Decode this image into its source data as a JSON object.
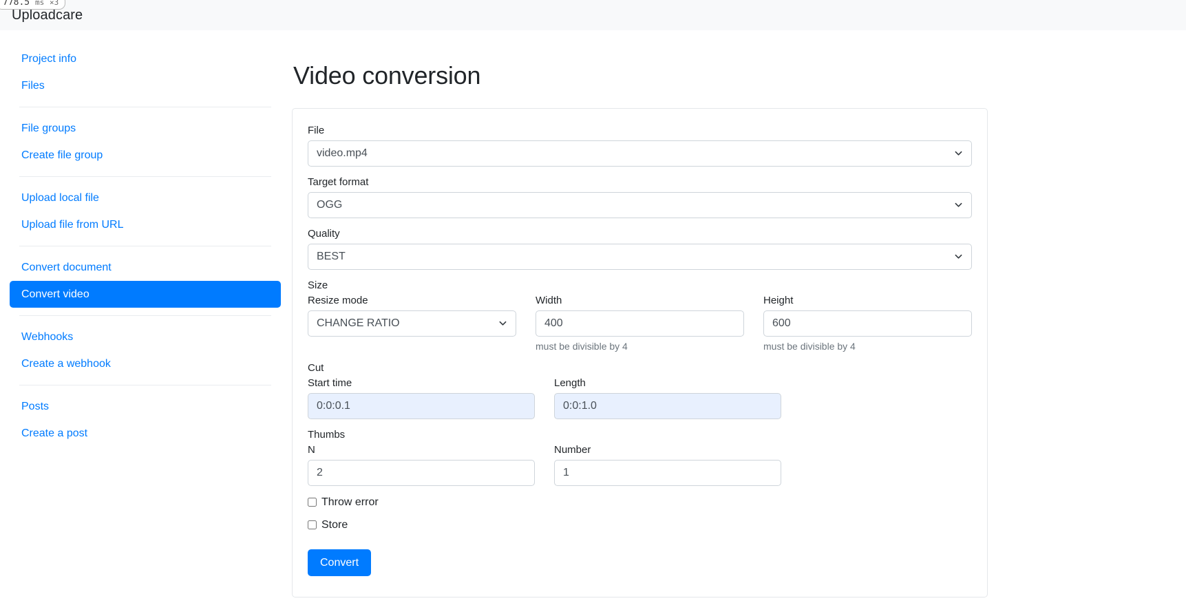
{
  "perf": {
    "value": "778.5",
    "unit": "ms",
    "multiplier": "×3"
  },
  "navbar": {
    "brand": "Uploadcare"
  },
  "sidebar": {
    "groups": [
      {
        "items": [
          {
            "label": "Project info",
            "active": false
          },
          {
            "label": "Files",
            "active": false
          }
        ]
      },
      {
        "items": [
          {
            "label": "File groups",
            "active": false
          },
          {
            "label": "Create file group",
            "active": false
          }
        ]
      },
      {
        "items": [
          {
            "label": "Upload local file",
            "active": false
          },
          {
            "label": "Upload file from URL",
            "active": false
          }
        ]
      },
      {
        "items": [
          {
            "label": "Convert document",
            "active": false
          },
          {
            "label": "Convert video",
            "active": true
          }
        ]
      },
      {
        "items": [
          {
            "label": "Webhooks",
            "active": false
          },
          {
            "label": "Create a webhook",
            "active": false
          }
        ]
      },
      {
        "items": [
          {
            "label": "Posts",
            "active": false
          },
          {
            "label": "Create a post",
            "active": false
          }
        ]
      }
    ]
  },
  "main": {
    "title": "Video conversion",
    "fields": {
      "file": {
        "label": "File",
        "value": "video.mp4"
      },
      "target_format": {
        "label": "Target format",
        "value": "OGG"
      },
      "quality": {
        "label": "Quality",
        "value": "BEST"
      },
      "size_section": {
        "label": "Size"
      },
      "resize_mode": {
        "label": "Resize mode",
        "value": "CHANGE RATIO"
      },
      "width": {
        "label": "Width",
        "value": "400",
        "help": "must be divisible by 4"
      },
      "height": {
        "label": "Height",
        "value": "600",
        "help": "must be divisible by 4"
      },
      "cut_section": {
        "label": "Cut"
      },
      "start_time": {
        "label": "Start time",
        "value": "0:0:0.1"
      },
      "length": {
        "label": "Length",
        "value": "0:0:1.0"
      },
      "thumbs_section": {
        "label": "Thumbs"
      },
      "thumbs_n": {
        "label": "N",
        "value": "2"
      },
      "thumbs_number": {
        "label": "Number",
        "value": "1"
      }
    },
    "checkboxes": [
      {
        "label": "Throw error",
        "checked": false
      },
      {
        "label": "Store",
        "checked": false
      }
    ],
    "submit": {
      "label": "Convert"
    }
  },
  "colors": {
    "accent": "#007bff",
    "navbar_bg": "#f8f9fa",
    "highlight_input": "#e8f0fe",
    "muted_text": "#6c757d",
    "border": "#ced4da"
  }
}
